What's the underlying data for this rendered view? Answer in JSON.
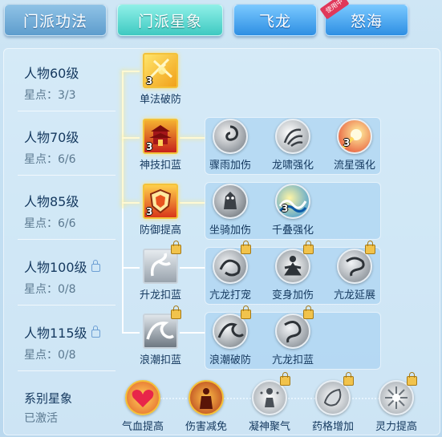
{
  "tabs": [
    {
      "label": "门派功法"
    },
    {
      "label": "门派星象"
    },
    {
      "label": "飞龙"
    },
    {
      "label": "怒海",
      "badge": "使用中"
    }
  ],
  "rows": [
    {
      "level": "人物60级",
      "stars": "星点：3/3",
      "locked": false
    },
    {
      "level": "人物70级",
      "stars": "星点：6/6",
      "locked": false
    },
    {
      "level": "人物85级",
      "stars": "星点：6/6",
      "locked": false
    },
    {
      "level": "人物100级",
      "stars": "星点：0/8",
      "locked": true
    },
    {
      "level": "人物115级",
      "stars": "星点：0/8",
      "locked": true
    }
  ],
  "series": {
    "title": "系别星象",
    "status": "已激活"
  },
  "skills": {
    "r1": [
      {
        "name": "单法破防",
        "count": "3",
        "icon": "magic-break-icon"
      }
    ],
    "r2": [
      {
        "name": "神技扣蓝",
        "count": "3",
        "icon": "temple-icon"
      },
      {
        "name": "骤雨加伤",
        "count": "",
        "icon": "swirl-icon"
      },
      {
        "name": "龙啸强化",
        "count": "",
        "icon": "claw-icon"
      },
      {
        "name": "流星强化",
        "count": "3",
        "icon": "meteor-icon"
      }
    ],
    "r3": [
      {
        "name": "防御提高",
        "count": "3",
        "icon": "shield-fire-icon"
      },
      {
        "name": "坐骑加伤",
        "count": "",
        "icon": "beast-icon"
      },
      {
        "name": "千叠强化",
        "count": "3",
        "icon": "wave-icon"
      }
    ],
    "r4": [
      {
        "name": "升龙扣蓝",
        "count": "",
        "icon": "rising-dragon-icon"
      },
      {
        "name": "亢龙打宠",
        "count": "",
        "icon": "dragon-icon"
      },
      {
        "name": "变身加伤",
        "count": "",
        "icon": "meditate-icon"
      },
      {
        "name": "亢龙延展",
        "count": "",
        "icon": "dragon-coil-icon"
      }
    ],
    "r5": [
      {
        "name": "浪潮扣蓝",
        "count": "",
        "icon": "tide-icon"
      },
      {
        "name": "浪潮破防",
        "count": "",
        "icon": "wave-break-icon"
      },
      {
        "name": "亢龙扣蓝",
        "count": "",
        "icon": "dragon-mana-icon"
      }
    ],
    "series": [
      {
        "name": "气血提高",
        "icon": "heart-icon"
      },
      {
        "name": "伤害减免",
        "icon": "armor-icon"
      },
      {
        "name": "凝神聚气",
        "icon": "focus-icon"
      },
      {
        "name": "药格增加",
        "icon": "potion-icon"
      },
      {
        "name": "灵力提高",
        "icon": "spirit-icon"
      }
    ]
  },
  "colors": {
    "active_tab": "#3fc9c1",
    "gold_frame": "#f3c23a",
    "text": "#163a60"
  }
}
